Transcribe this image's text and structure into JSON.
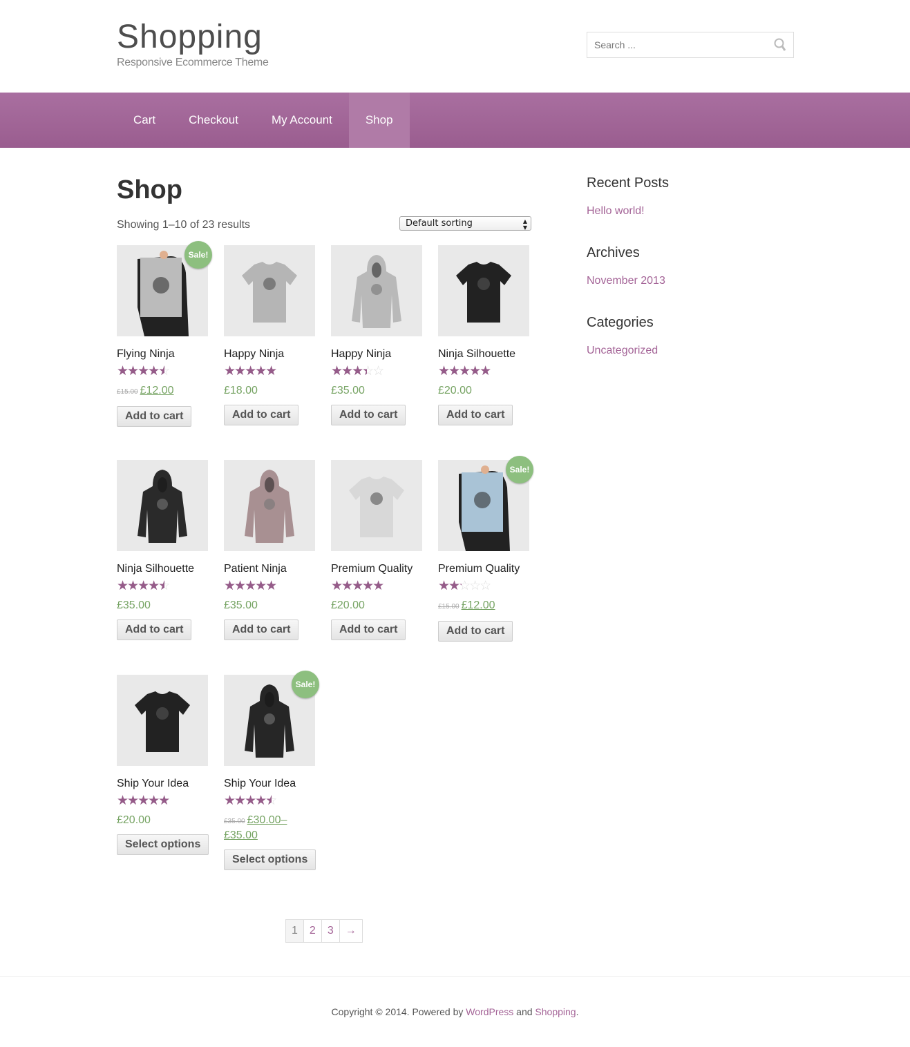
{
  "header": {
    "title": "Shopping",
    "tagline": "Responsive Ecommerce Theme",
    "search_placeholder": "Search ..."
  },
  "nav": {
    "items": [
      {
        "label": "Cart"
      },
      {
        "label": "Checkout"
      },
      {
        "label": "My Account"
      },
      {
        "label": "Shop",
        "active": true
      }
    ],
    "accent": "#a46497"
  },
  "main": {
    "title": "Shop",
    "result_count": "Showing 1–10 of 23 results",
    "sorting": "Default sorting"
  },
  "products": [
    {
      "name": "Flying Ninja",
      "rating": 4,
      "old_price": "£15.00",
      "price": "£12.00",
      "sale": true,
      "button": "Add to cart",
      "type": "poster",
      "color": "#bbbbbb"
    },
    {
      "name": "Happy Ninja",
      "rating": 5,
      "price": "£18.00",
      "button": "Add to cart",
      "type": "tshirt",
      "color": "#b5b5b5"
    },
    {
      "name": "Happy Ninja",
      "rating": 3,
      "price": "£35.00",
      "button": "Add to cart",
      "type": "hoodie",
      "color": "#b9b9b9"
    },
    {
      "name": "Ninja Silhouette",
      "rating": 5,
      "price": "£20.00",
      "button": "Add to cart",
      "type": "tshirt",
      "color": "#222222"
    },
    {
      "name": "Ninja Silhouette",
      "rating": 4,
      "price": "£35.00",
      "button": "Add to cart",
      "type": "hoodie",
      "color": "#2a2a2a"
    },
    {
      "name": "Patient Ninja",
      "rating": 4.75,
      "price": "£35.00",
      "button": "Add to cart",
      "type": "hoodie",
      "color": "#a89092"
    },
    {
      "name": "Premium Quality",
      "rating": 4.6,
      "price": "£20.00",
      "button": "Add to cart",
      "type": "tshirt",
      "color": "#d8d8d8"
    },
    {
      "name": "Premium Quality",
      "rating": 2,
      "old_price": "£15.00",
      "price": "£12.00",
      "sale": true,
      "button": "Add to cart",
      "type": "poster",
      "color": "#a9c3d6"
    },
    {
      "name": "Ship Your Idea",
      "rating": 4.6,
      "price": "£20.00",
      "button": "Select options",
      "type": "tshirt",
      "color": "#222222"
    },
    {
      "name": "Ship Your Idea",
      "rating": 4,
      "old_price": "£35.00",
      "price": "£30.00–",
      "price2": "£35.00",
      "sale": true,
      "button": "Select options",
      "type": "hoodie",
      "color": "#262626"
    }
  ],
  "sale_label": "Sale!",
  "pagination": [
    "1",
    "2",
    "3",
    "→"
  ],
  "sidebar": [
    {
      "title": "Recent Posts",
      "links": [
        "Hello world!"
      ]
    },
    {
      "title": "Archives",
      "links": [
        "November 2013"
      ]
    },
    {
      "title": "Categories",
      "links": [
        "Uncategorized"
      ]
    }
  ],
  "footer": {
    "text1": "Copyright © 2014. Powered by ",
    "link1": "WordPress",
    "text2": " and ",
    "link2": "Shopping",
    "text3": "."
  }
}
